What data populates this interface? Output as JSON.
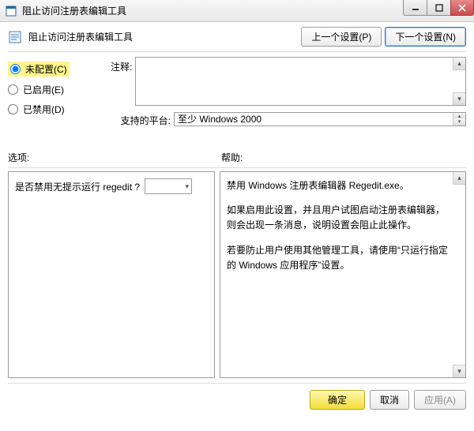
{
  "window": {
    "title": "阻止访问注册表编辑工具"
  },
  "header": {
    "title": "阻止访问注册表编辑工具",
    "prev_btn": "上一个设置(P)",
    "next_btn": "下一个设置(N)"
  },
  "radios": {
    "not_configured": "未配置(C)",
    "enabled": "已启用(E)",
    "disabled": "已禁用(D)"
  },
  "labels": {
    "comment": "注释:",
    "supported": "支持的平台:",
    "options": "选项:",
    "help": "帮助:"
  },
  "supported_value": "至少 Windows 2000",
  "options_panel": {
    "question": "是否禁用无提示运行 regedit ?"
  },
  "help_panel": {
    "p1": "禁用 Windows 注册表编辑器 Regedit.exe。",
    "p2": "如果启用此设置，并且用户试图启动注册表编辑器，则会出现一条消息，说明设置会阻止此操作。",
    "p3": "若要防止用户使用其他管理工具，请使用“只运行指定的 Windows 应用程序”设置。"
  },
  "footer": {
    "ok": "确定",
    "cancel": "取消",
    "apply": "应用(A)"
  }
}
